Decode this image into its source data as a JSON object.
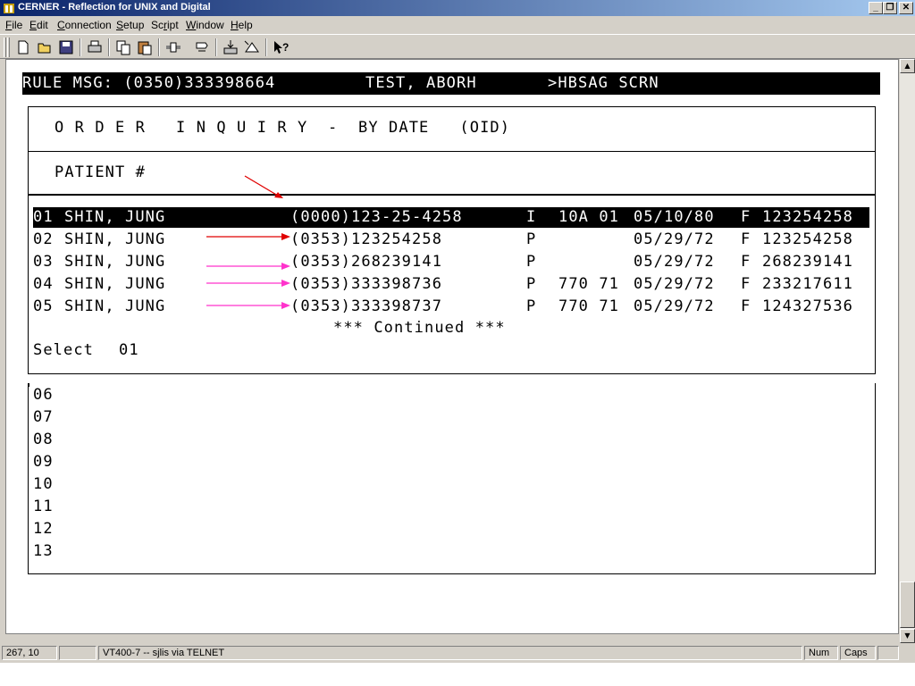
{
  "window": {
    "title": "CERNER - Reflection for UNIX and Digital"
  },
  "menu": [
    "File",
    "Edit",
    "Connection",
    "Setup",
    "Script",
    "Window",
    "Help"
  ],
  "menu_mnemonics": [
    "F",
    "E",
    "C",
    "S",
    "r",
    "W",
    "H"
  ],
  "toolbar_icons": [
    "new-icon",
    "open-icon",
    "save-icon",
    "print-icon",
    "copy-icon",
    "paste-icon",
    "connect-icon",
    "macro-icon",
    "transfer-icon",
    "receive-icon",
    "context-help-icon"
  ],
  "terminal": {
    "rule_msg": "RULE MSG: (0350)333398664",
    "rule_patient": "TEST, ABORH",
    "rule_screen": ">HBSAG SCRN",
    "screen_title": "O R D E R   I N Q U I R Y  -  BY DATE   (OID)",
    "patient_label": "PATIENT #",
    "rows": [
      {
        "num": "01",
        "name": "SHIN, JUNG",
        "id": "(0000)123-25-4258",
        "type": "I",
        "loc": "10A 01",
        "dob": "05/10/80",
        "sex": "F",
        "mrn": "123254258"
      },
      {
        "num": "02",
        "name": "SHIN, JUNG",
        "id": "(0353)123254258",
        "type": "P",
        "loc": "",
        "dob": "05/29/72",
        "sex": "F",
        "mrn": "123254258"
      },
      {
        "num": "03",
        "name": "SHIN, JUNG",
        "id": "(0353)268239141",
        "type": "P",
        "loc": "",
        "dob": "05/29/72",
        "sex": "F",
        "mrn": "268239141"
      },
      {
        "num": "04",
        "name": "SHIN, JUNG",
        "id": "(0353)333398736",
        "type": "P",
        "loc": "770 71",
        "dob": "05/29/72",
        "sex": "F",
        "mrn": "233217611"
      },
      {
        "num": "05",
        "name": "SHIN, JUNG",
        "id": "(0353)333398737",
        "type": "P",
        "loc": "770 71",
        "dob": "05/29/72",
        "sex": "F",
        "mrn": "124327536"
      }
    ],
    "continued": "*** Continued ***",
    "select_label": "Select",
    "select_value": "01",
    "empty_rows": [
      "06",
      "07",
      "08",
      "09",
      "10",
      "11",
      "12",
      "13"
    ]
  },
  "status": {
    "cursor": "267, 10",
    "session": "VT400-7 -- sjlis via TELNET",
    "num": "Num",
    "caps": "Caps"
  },
  "colors": {
    "arrow_red": "#e00000",
    "arrow_magenta": "#ff33cc",
    "title_start": "#0a246a"
  }
}
